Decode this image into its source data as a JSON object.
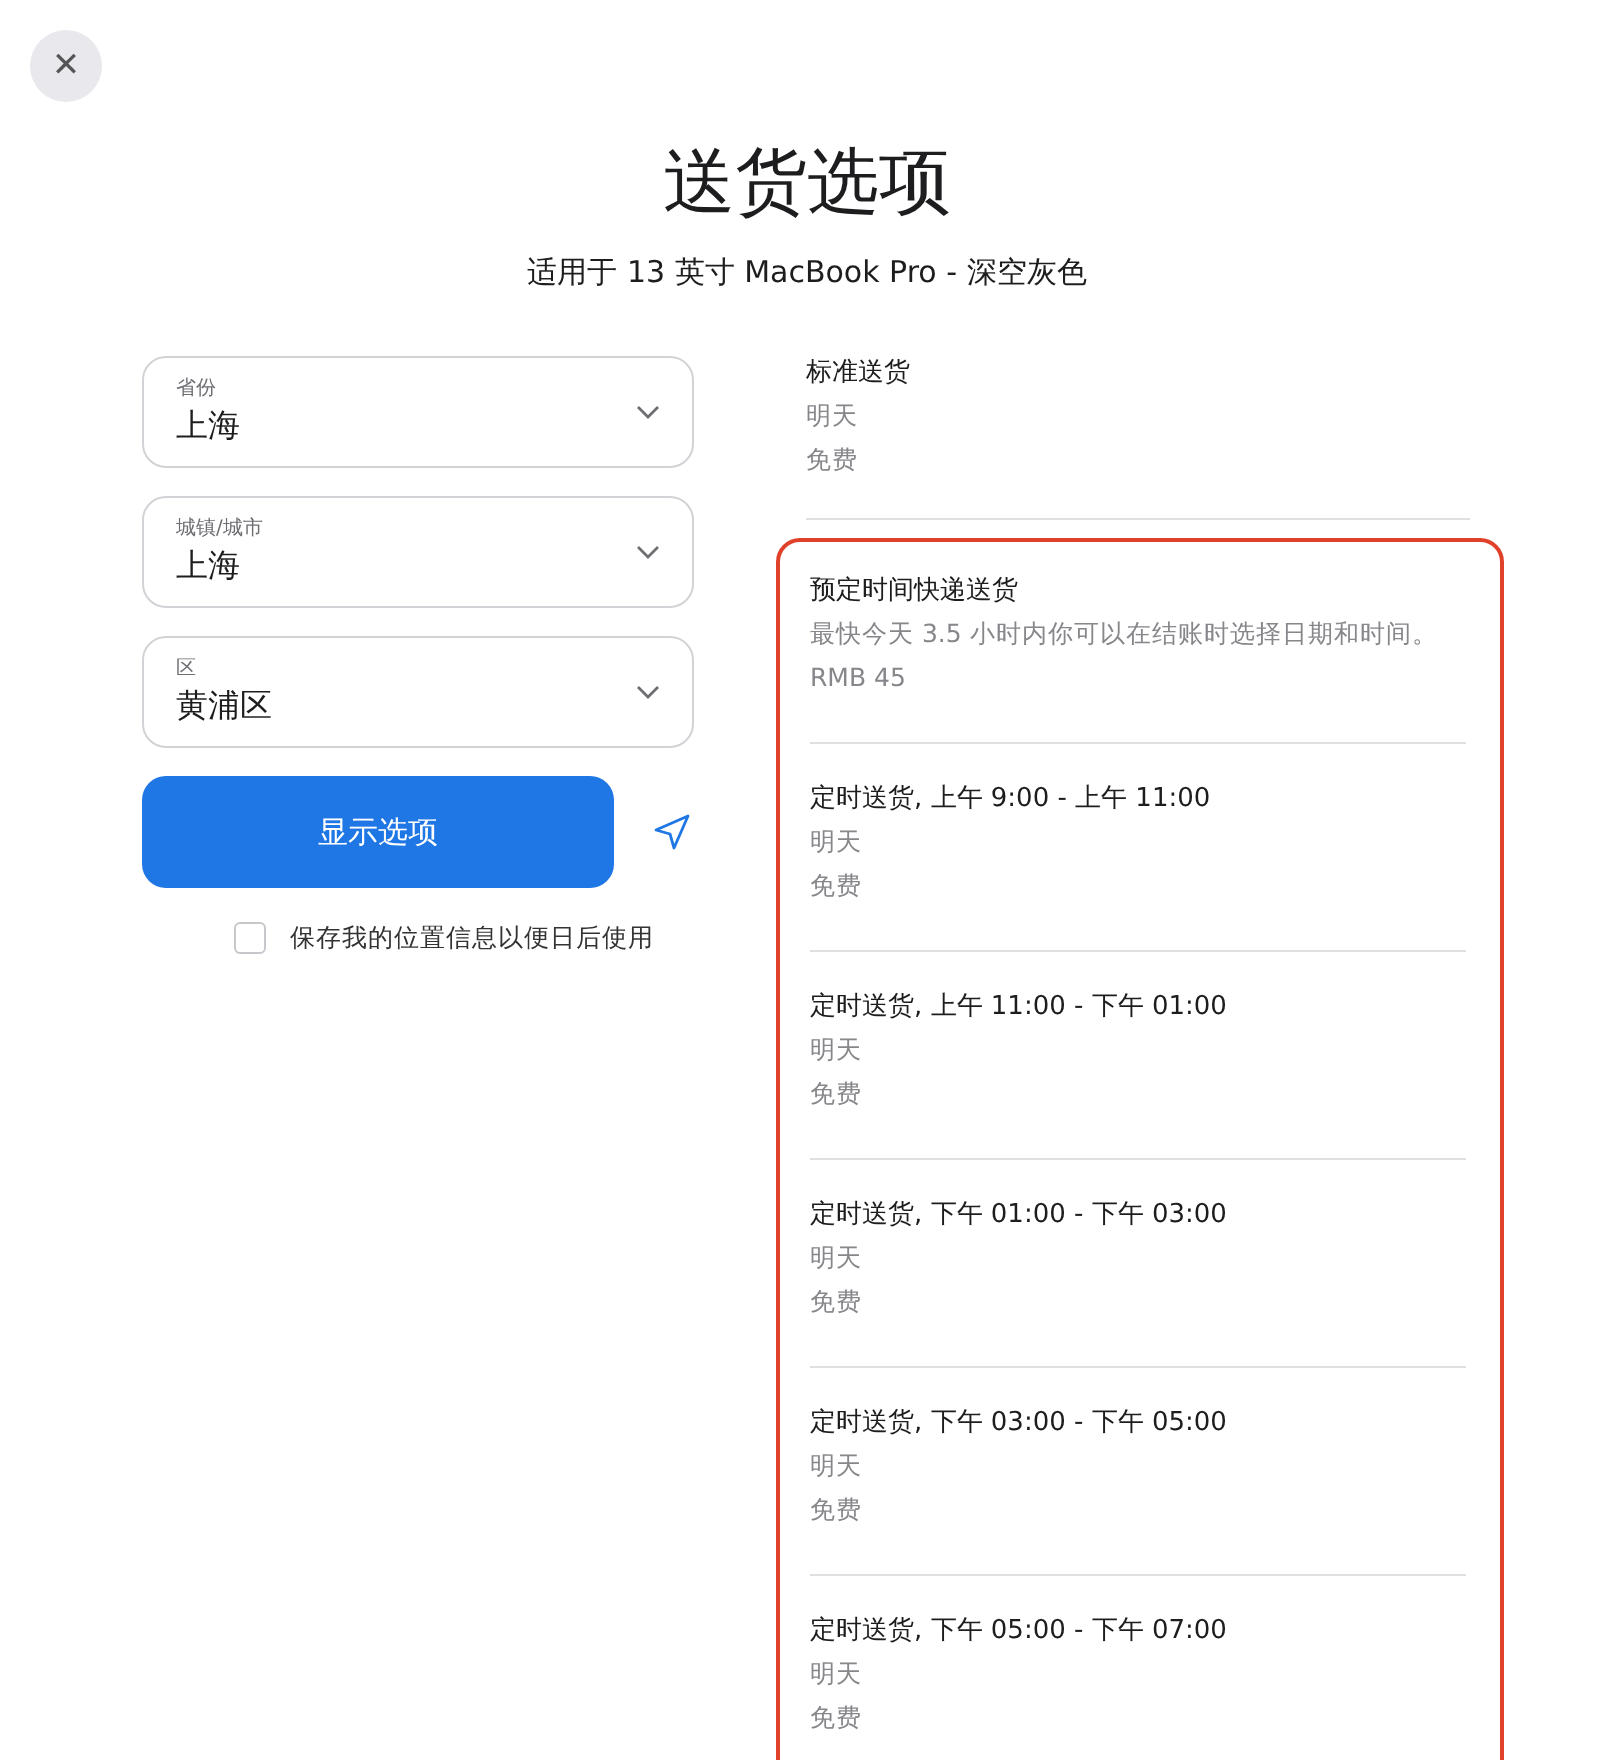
{
  "close_button": {
    "label": "✕"
  },
  "title": "送货选项",
  "subtitle": "适用于 13 英寸 MacBook Pro - 深空灰色",
  "fields": [
    {
      "label": "省份",
      "value": "上海"
    },
    {
      "label": "城镇/城市",
      "value": "上海"
    },
    {
      "label": "区",
      "value": "黄浦区"
    }
  ],
  "show_button": {
    "label": "显示选项"
  },
  "save_location": {
    "label": "保存我的位置信息以便日后使用",
    "checked": false
  },
  "options": [
    {
      "name": "标准送货",
      "lines": [
        "明天",
        "免费"
      ],
      "highlighted": false
    },
    {
      "name": "预定时间快递送货",
      "lines": [
        "最快今天 3.5 小时内你可以在结账时选择日期和时间。",
        "RMB 45"
      ],
      "highlighted": true
    },
    {
      "name": "定时送货, 上午 9:00 - 上午 11:00",
      "lines": [
        "明天",
        "免费"
      ],
      "highlighted": true
    },
    {
      "name": "定时送货, 上午 11:00 - 下午 01:00",
      "lines": [
        "明天",
        "免费"
      ],
      "highlighted": true
    },
    {
      "name": "定时送货, 下午 01:00 - 下午 03:00",
      "lines": [
        "明天",
        "免费"
      ],
      "highlighted": true
    },
    {
      "name": "定时送货, 下午 03:00 - 下午 05:00",
      "lines": [
        "明天",
        "免费"
      ],
      "highlighted": true
    },
    {
      "name": "定时送货, 下午 05:00 - 下午 07:00",
      "lines": [
        "明天",
        "免费"
      ],
      "highlighted": true
    }
  ]
}
